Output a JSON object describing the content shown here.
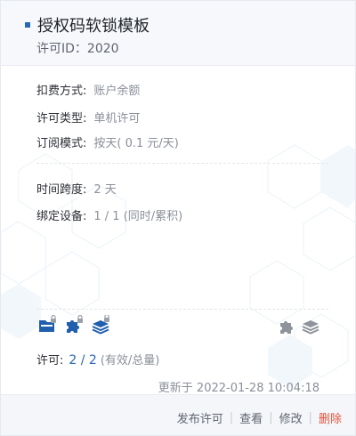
{
  "header": {
    "title": "授权码软锁模板",
    "license_id": "许可ID：2020"
  },
  "details": {
    "billing_label": "扣费方式:",
    "billing_value": "账户余额",
    "license_type_label": "许可类型:",
    "license_type_value": "单机许可",
    "subscription_label": "订阅模式:",
    "subscription_value": "按天( 0.1 元/天)",
    "time_span_label": "时间跨度:",
    "time_span_value": "2 天",
    "bound_devices_label": "绑定设备:",
    "bound_devices_value": "1 / 1 (同时/累积)"
  },
  "icons": {
    "left": [
      "folder-lock-icon",
      "puzzle-lock-icon",
      "layers-lock-icon"
    ],
    "right": [
      "puzzle-icon",
      "layers-icon"
    ]
  },
  "license": {
    "label": "许可:",
    "count": "2 / 2",
    "note": "(有效/总量)"
  },
  "updated": "更新于 2022-01-28 10:04:18",
  "actions": {
    "publish": "发布许可",
    "view": "查看",
    "edit": "修改",
    "delete": "删除"
  },
  "colors": {
    "accent": "#2866b5",
    "danger": "#e5533b",
    "muted": "#8a8f99"
  }
}
